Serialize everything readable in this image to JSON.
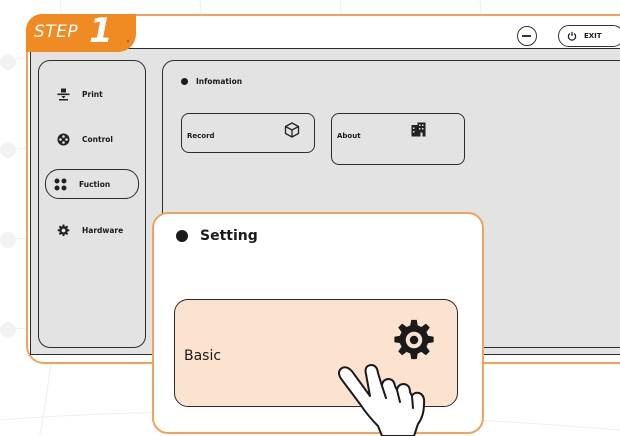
{
  "step": {
    "text": "STEP",
    "number": "1"
  },
  "header": {
    "exit_label": "EXIT"
  },
  "sidebar": {
    "items": [
      {
        "label": "Print",
        "icon": "print-icon"
      },
      {
        "label": "Control",
        "icon": "control-icon"
      },
      {
        "label": "Fuction",
        "icon": "function-icon",
        "active": true
      },
      {
        "label": "Hardware",
        "icon": "gear-icon"
      }
    ]
  },
  "main": {
    "section_title": "Infomation",
    "cards": [
      {
        "label": "Record",
        "icon": "cube-icon"
      },
      {
        "label": "About",
        "icon": "building-icon"
      }
    ]
  },
  "popup": {
    "section_title": "Setting",
    "card": {
      "label": "Basic",
      "icon": "gear-icon"
    }
  },
  "colors": {
    "accent": "#f08a23",
    "accent_border": "#f0a35b",
    "screen_bg": "#e3e3e3",
    "highlight_bg": "#fbe3cf"
  }
}
